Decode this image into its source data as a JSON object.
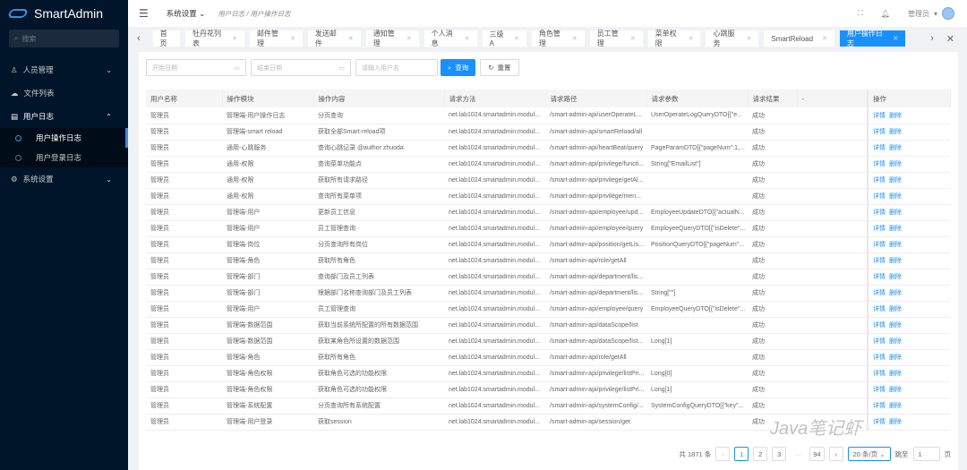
{
  "app": {
    "title": "SmartAdmin",
    "search_placeholder": "搜索"
  },
  "sidebar": {
    "items": [
      {
        "label": "人员管理",
        "icon": "user-icon",
        "chevron": "⌄"
      },
      {
        "label": "文件列表",
        "icon": "cloud-icon",
        "chevron": ""
      },
      {
        "label": "用户日志",
        "icon": "log-icon",
        "chevron": "⌃",
        "open": true,
        "children": [
          {
            "label": "用户操作日志",
            "active": true
          },
          {
            "label": "用户登录日志"
          }
        ]
      },
      {
        "label": "系统设置",
        "icon": "settings-icon",
        "chevron": "⌄"
      }
    ]
  },
  "header": {
    "menu": "系统设置",
    "breadcrumb": [
      "用户日志",
      "用户操作日志"
    ],
    "user": "管理员"
  },
  "tabs": [
    {
      "label": "首页"
    },
    {
      "label": "牡丹花列表"
    },
    {
      "label": "邮件管理"
    },
    {
      "label": "发送邮件"
    },
    {
      "label": "通知管理"
    },
    {
      "label": "个人消息"
    },
    {
      "label": "三级A"
    },
    {
      "label": "角色管理"
    },
    {
      "label": "员工管理"
    },
    {
      "label": "菜单权限"
    },
    {
      "label": "心跳服务"
    },
    {
      "label": "SmartReload"
    },
    {
      "label": "用户操作日志",
      "active": true
    }
  ],
  "filters": {
    "start_placeholder": "开始日期",
    "end_placeholder": "结束日期",
    "user_placeholder": "请输入用户名",
    "query": "查询",
    "reset": "重置"
  },
  "table": {
    "columns": [
      "用户名称",
      "操作模块",
      "操作内容",
      "请求方法",
      "请求路径",
      "请求参数",
      "请求结果",
      "-",
      "操作"
    ],
    "actions": [
      "详情",
      "删除"
    ],
    "rows": [
      [
        "管理员",
        "管理端-用户操作日志",
        "分页查询",
        "net.lab1024.smartadmin.modul...",
        "/smart-admin-api/userOperateL...",
        "UserOperateLogQueryDTO[{\"e...",
        "成功",
        ""
      ],
      [
        "管理员",
        "管理端-smart reload",
        "获取全部Smart-reload项",
        "net.lab1024.smartadmin.modul...",
        "/smart-admin-api/smartReload/all",
        "",
        "成功",
        ""
      ],
      [
        "管理员",
        "通用-心跳服务",
        "查询心跳记录 @author zhuoda",
        "net.lab1024.smartadmin.modul...",
        "/smart-admin-api/heartBeat/query",
        "PageParamDTO[{\"pageNum\":1,...",
        "成功",
        ""
      ],
      [
        "管理员",
        "通用-权限",
        "查询菜单功能点",
        "net.lab1024.smartadmin.modul...",
        "/smart-admin-api/privilege/functi...",
        "String[\"EmailList\"]",
        "成功",
        ""
      ],
      [
        "管理员",
        "通用-权限",
        "获取所有请求路径",
        "net.lab1024.smartadmin.modul...",
        "/smart-admin-api/privilege/getAl...",
        "",
        "成功",
        ""
      ],
      [
        "管理员",
        "通用-权限",
        "查询所有菜单项",
        "net.lab1024.smartadmin.modul...",
        "/smart-admin-api/privilege/men...",
        "",
        "成功",
        ""
      ],
      [
        "管理员",
        "管理端-用户",
        "更新员工信息",
        "net.lab1024.smartadmin.modul...",
        "/smart-admin-api/employee/upd...",
        "EmployeeUpdateDTO[{\"actualN...",
        "成功",
        ""
      ],
      [
        "管理员",
        "管理端-用户",
        "员工管理查询",
        "net.lab1024.smartadmin.modul...",
        "/smart-admin-api/employee/query",
        "EmployeeQueryDTO[{\"isDelete\"...",
        "成功",
        ""
      ],
      [
        "管理员",
        "管理端-岗位",
        "分页查询所有岗位",
        "net.lab1024.smartadmin.modul...",
        "/smart-admin-api/position/getLis...",
        "PositionQueryDTO[{\"pageNum\"...",
        "成功",
        ""
      ],
      [
        "管理员",
        "管理端-角色",
        "获取所有角色",
        "net.lab1024.smartadmin.modul...",
        "/smart-admin-api/role/getAll",
        "",
        "成功",
        ""
      ],
      [
        "管理员",
        "管理端-部门",
        "查询部门及员工列表",
        "net.lab1024.smartadmin.modul...",
        "/smart-admin-api/department/lis...",
        "",
        "成功",
        ""
      ],
      [
        "管理员",
        "管理端-部门",
        "根据部门名称查询部门及员工列表",
        "net.lab1024.smartadmin.modul...",
        "/smart-admin-api/department/lis...",
        "String[\"\"]",
        "成功",
        ""
      ],
      [
        "管理员",
        "管理端-用户",
        "员工管理查询",
        "net.lab1024.smartadmin.modul...",
        "/smart-admin-api/employee/query",
        "EmployeeQueryDTO[{\"isDelete\"...",
        "成功",
        ""
      ],
      [
        "管理员",
        "管理端-数据范围",
        "获取当前系统所配置的所有数据范围",
        "net.lab1024.smartadmin.modul...",
        "/smart-admin-api/dataScope/list",
        "",
        "成功",
        ""
      ],
      [
        "管理员",
        "管理端-数据范围",
        "获取某角色所设置的数据范围",
        "net.lab1024.smartadmin.modul...",
        "/smart-admin-api/dataScope/list...",
        "Long[1]",
        "成功",
        ""
      ],
      [
        "管理员",
        "管理端-角色",
        "获取所有角色",
        "net.lab1024.smartadmin.modul...",
        "/smart-admin-api/role/getAll",
        "",
        "成功",
        ""
      ],
      [
        "管理员",
        "管理端-角色权限",
        "获取角色可选的功能权限",
        "net.lab1024.smartadmin.modul...",
        "/smart-admin-api/privilege/listPri...",
        "Long[0]",
        "成功",
        ""
      ],
      [
        "管理员",
        "管理端-角色权限",
        "获取角色可选的功能权限",
        "net.lab1024.smartadmin.modul...",
        "/smart-admin-api/privilege/listPri...",
        "Long[1]",
        "成功",
        ""
      ],
      [
        "管理员",
        "管理端-系统配置",
        "分页查询所有系统配置",
        "net.lab1024.smartadmin.modul...",
        "/smart-admin-api/systemConfig/...",
        "SystemConfigQueryDTO[{\"key\"...",
        "成功",
        ""
      ],
      [
        "管理员",
        "管理端-用户登录",
        "获取session",
        "net.lab1024.smartadmin.modul...",
        "/smart-admin-api/session/get",
        "",
        "成功",
        ""
      ]
    ]
  },
  "pagination": {
    "total": "共 1871 条",
    "pages": [
      "1",
      "2",
      "3",
      "···",
      "94"
    ],
    "current": "1",
    "page_size": "20 条/页",
    "jump_label": "跳至",
    "jump_value": "1",
    "page_suffix": "页"
  },
  "watermark": "Java笔记虾",
  "colors": {
    "sidebar": "#001529",
    "accent": "#1890ff"
  }
}
